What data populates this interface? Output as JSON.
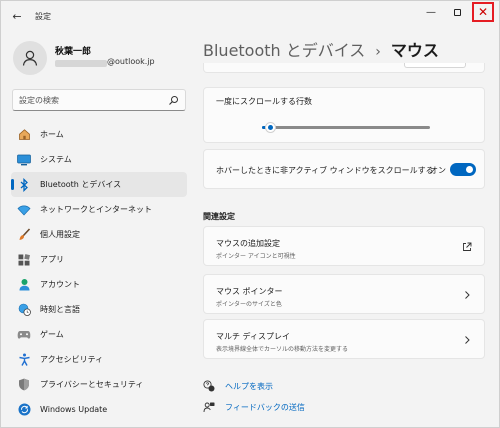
{
  "window": {
    "title": "設定"
  },
  "titlebar": {
    "minimize_glyph": "—",
    "close_glyph": "✕"
  },
  "account": {
    "name": "秋葉一郎",
    "email_suffix": "@outlook.jp"
  },
  "search": {
    "placeholder": "設定の検索"
  },
  "nav": {
    "items": [
      {
        "id": "home",
        "label": "ホーム",
        "icon": "home-icon"
      },
      {
        "id": "system",
        "label": "システム",
        "icon": "system-icon"
      },
      {
        "id": "bluetooth",
        "label": "Bluetooth とデバイス",
        "icon": "bluetooth-icon",
        "active": true
      },
      {
        "id": "network",
        "label": "ネットワークとインターネット",
        "icon": "wifi-icon"
      },
      {
        "id": "personalization",
        "label": "個人用設定",
        "icon": "brush-icon"
      },
      {
        "id": "apps",
        "label": "アプリ",
        "icon": "apps-icon"
      },
      {
        "id": "accounts",
        "label": "アカウント",
        "icon": "account-icon"
      },
      {
        "id": "time-language",
        "label": "時刻と言語",
        "icon": "globe-clock-icon"
      },
      {
        "id": "gaming",
        "label": "ゲーム",
        "icon": "gamepad-icon"
      },
      {
        "id": "accessibility",
        "label": "アクセシビリティ",
        "icon": "accessibility-icon"
      },
      {
        "id": "privacy",
        "label": "プライバシーとセキュリティ",
        "icon": "shield-icon"
      },
      {
        "id": "windows-update",
        "label": "Windows Update",
        "icon": "update-icon"
      }
    ]
  },
  "header": {
    "parent": "Bluetooth とデバイス",
    "separator": "›",
    "current": "マウス"
  },
  "settings": {
    "scroll_lines": {
      "label": "一度にスクロールする行数",
      "value_fraction": 0.04
    },
    "scroll_inactive": {
      "label": "ホバーしたときに非アクティブ ウィンドウをスクロールする",
      "state": "オン",
      "on": true
    }
  },
  "related": {
    "title": "関連設定",
    "items": [
      {
        "title": "マウスの追加設定",
        "subtitle": "ポインター アイコンと可視性",
        "icon": "external-link-icon"
      },
      {
        "title": "マウス ポインター",
        "subtitle": "ポインターのサイズと色",
        "icon": "chevron-right-icon"
      },
      {
        "title": "マルチ ディスプレイ",
        "subtitle": "表示境界線全体でカーソルの移動方法を変更する",
        "icon": "chevron-right-icon"
      }
    ]
  },
  "help": {
    "get_help": "ヘルプを表示",
    "feedback": "フィードバックの送信"
  },
  "colors": {
    "accent": "#0067c0",
    "close_highlight": "#e51c23"
  }
}
